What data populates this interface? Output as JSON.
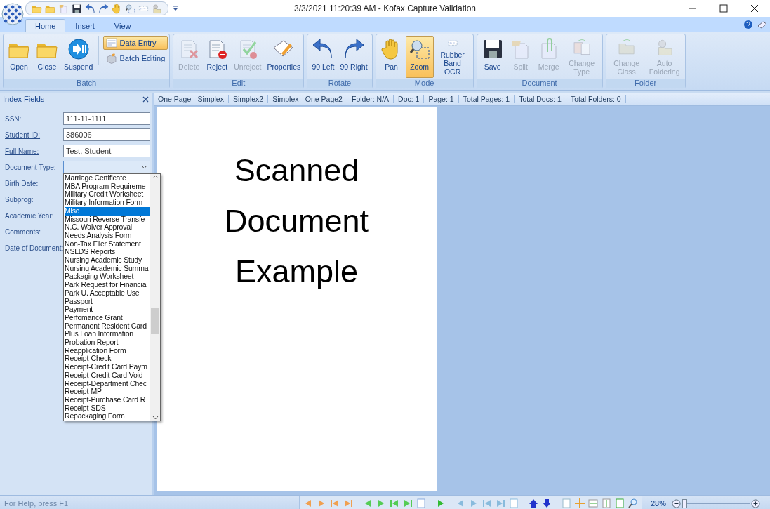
{
  "window": {
    "title": "3/3/2021 11:20:39 AM - Kofax Capture Validation"
  },
  "tabs": [
    {
      "label": "Home",
      "selected": true
    },
    {
      "label": "Insert",
      "selected": false
    },
    {
      "label": "View",
      "selected": false
    }
  ],
  "ribbon": [
    {
      "name": "Batch",
      "buttons": [
        {
          "label": "Open",
          "kind": "large",
          "disabled": false,
          "selected": false
        },
        {
          "label": "Close",
          "kind": "large",
          "disabled": false,
          "selected": false
        },
        {
          "label": "Suspend",
          "kind": "large",
          "disabled": false,
          "selected": false
        },
        {
          "label": "Data Entry",
          "kind": "small",
          "disabled": false,
          "selected": true
        },
        {
          "label": "Batch Editing",
          "kind": "small",
          "disabled": false,
          "selected": false
        }
      ]
    },
    {
      "name": "Edit",
      "buttons": [
        {
          "label": "Delete",
          "kind": "large",
          "disabled": true,
          "selected": false
        },
        {
          "label": "Reject",
          "kind": "large",
          "disabled": false,
          "selected": false
        },
        {
          "label": "Unreject",
          "kind": "large",
          "disabled": true,
          "selected": false
        },
        {
          "label": "Properties",
          "kind": "large",
          "disabled": false,
          "selected": false
        }
      ]
    },
    {
      "name": "Rotate",
      "buttons": [
        {
          "label": "90 Left",
          "kind": "large",
          "disabled": false,
          "selected": false
        },
        {
          "label": "90 Right",
          "kind": "large",
          "disabled": false,
          "selected": false
        }
      ]
    },
    {
      "name": "Mode",
      "buttons": [
        {
          "label": "Pan",
          "kind": "large",
          "disabled": false,
          "selected": false
        },
        {
          "label": "Zoom",
          "kind": "large",
          "disabled": false,
          "selected": true
        },
        {
          "label": "Rubber Band OCR",
          "kind": "large",
          "disabled": false,
          "selected": false
        }
      ]
    },
    {
      "name": "Document",
      "buttons": [
        {
          "label": "Save",
          "kind": "large",
          "disabled": false,
          "selected": false
        },
        {
          "label": "Split",
          "kind": "large",
          "disabled": true,
          "selected": false
        },
        {
          "label": "Merge",
          "kind": "large",
          "disabled": true,
          "selected": false
        },
        {
          "label": "Change Type",
          "kind": "large",
          "disabled": true,
          "selected": false
        }
      ]
    },
    {
      "name": "Folder",
      "buttons": [
        {
          "label": "Change Class",
          "kind": "large",
          "disabled": true,
          "selected": false
        },
        {
          "label": "Auto Foldering",
          "kind": "large",
          "disabled": true,
          "selected": false
        }
      ]
    }
  ],
  "index_panel": {
    "title": "Index Fields",
    "fields": [
      {
        "label": "SSN:",
        "linked": false,
        "kind": "text",
        "value": "111-11-1111"
      },
      {
        "label": "Student ID:",
        "linked": true,
        "kind": "text",
        "value": "386006"
      },
      {
        "label": "Full Name:",
        "linked": true,
        "kind": "text",
        "value": "Test, Student"
      },
      {
        "label": "Document Type:",
        "linked": true,
        "kind": "dropdown"
      },
      {
        "label": "Birth Date:",
        "linked": false,
        "kind": "hidden"
      },
      {
        "label": "Subprog:",
        "linked": false,
        "kind": "hidden"
      },
      {
        "label": "Academic Year:",
        "linked": false,
        "kind": "hidden"
      },
      {
        "label": "Comments:",
        "linked": false,
        "kind": "hidden"
      },
      {
        "label": "Date of Document:",
        "linked": false,
        "kind": "hidden"
      }
    ],
    "dropdown_options": [
      {
        "label": "Marriage Certificate",
        "selected": false
      },
      {
        "label": "MBA Program Requireme",
        "selected": false
      },
      {
        "label": "Military Credit Worksheet",
        "selected": false
      },
      {
        "label": "Military Information Form",
        "selected": false
      },
      {
        "label": "Misc",
        "selected": true
      },
      {
        "label": "Missouri Reverse Transfe",
        "selected": false
      },
      {
        "label": "N.C. Waiver Approval",
        "selected": false
      },
      {
        "label": "Needs Analysis Form",
        "selected": false
      },
      {
        "label": "Non-Tax Filer Statement",
        "selected": false
      },
      {
        "label": "NSLDS Reports",
        "selected": false
      },
      {
        "label": "Nursing Academic Study",
        "selected": false
      },
      {
        "label": "Nursing Academic Summa",
        "selected": false
      },
      {
        "label": "Packaging Worksheet",
        "selected": false
      },
      {
        "label": "Park Request for Financia",
        "selected": false
      },
      {
        "label": "Park U. Acceptable Use",
        "selected": false
      },
      {
        "label": "Passport",
        "selected": false
      },
      {
        "label": "Payment",
        "selected": false
      },
      {
        "label": "Perfomance Grant",
        "selected": false
      },
      {
        "label": "Permanent Resident Card",
        "selected": false
      },
      {
        "label": "Plus Loan Information",
        "selected": false
      },
      {
        "label": "Probation Report",
        "selected": false
      },
      {
        "label": "Reapplication Form",
        "selected": false
      },
      {
        "label": "Receipt-Check",
        "selected": false
      },
      {
        "label": "Receipt-Credit Card Paym",
        "selected": false
      },
      {
        "label": "Receipt-Credit Card Void",
        "selected": false
      },
      {
        "label": "Receipt-Department Chec",
        "selected": false
      },
      {
        "label": "Receipt-MP",
        "selected": false
      },
      {
        "label": "Receipt-Purchase Card R",
        "selected": false
      },
      {
        "label": "Receipt-SDS",
        "selected": false
      },
      {
        "label": "Repackaging Form",
        "selected": false
      }
    ]
  },
  "info_bar": [
    "One Page - Simplex",
    "Simplex2",
    "Simplex - One Page2",
    "Folder: N/A",
    "Doc: 1",
    "Page: 1",
    "Total Pages: 1",
    "Total Docs: 1",
    "Total Folders: 0"
  ],
  "document": {
    "text": "Scanned Document Example"
  },
  "status_bar": {
    "help": "For Help, press F1",
    "zoom": "28%",
    "zoom_slider": {
      "level": 0.04
    }
  }
}
